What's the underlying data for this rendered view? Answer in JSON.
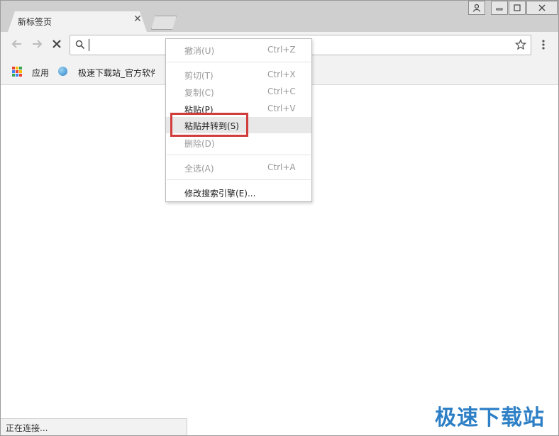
{
  "tab": {
    "title": "新标签页"
  },
  "toolbar": {
    "omnibox_value": ""
  },
  "bookmarks": [
    {
      "label": "应用",
      "icon": "apps-grid-icon"
    },
    {
      "label": "极速下载站_官方软件",
      "icon": "globe-icon"
    }
  ],
  "context_menu": {
    "undo": {
      "label": "撤消(U)",
      "shortcut": "Ctrl+Z"
    },
    "cut": {
      "label": "剪切(T)",
      "shortcut": "Ctrl+X"
    },
    "copy": {
      "label": "复制(C)",
      "shortcut": "Ctrl+C"
    },
    "paste": {
      "label": "粘贴(P)",
      "shortcut": "Ctrl+V"
    },
    "paste_and_go": {
      "label": "粘贴并转到(S)"
    },
    "delete": {
      "label": "删除(D)"
    },
    "select_all": {
      "label": "全选(A)",
      "shortcut": "Ctrl+A"
    },
    "edit_search_engines": {
      "label": "修改搜索引擎(E)..."
    }
  },
  "status": {
    "text": "正在连接..."
  },
  "watermark": {
    "text": "极速下载站"
  },
  "colors": {
    "highlight": "#d13c3c",
    "watermark": "#2d7fc6"
  }
}
